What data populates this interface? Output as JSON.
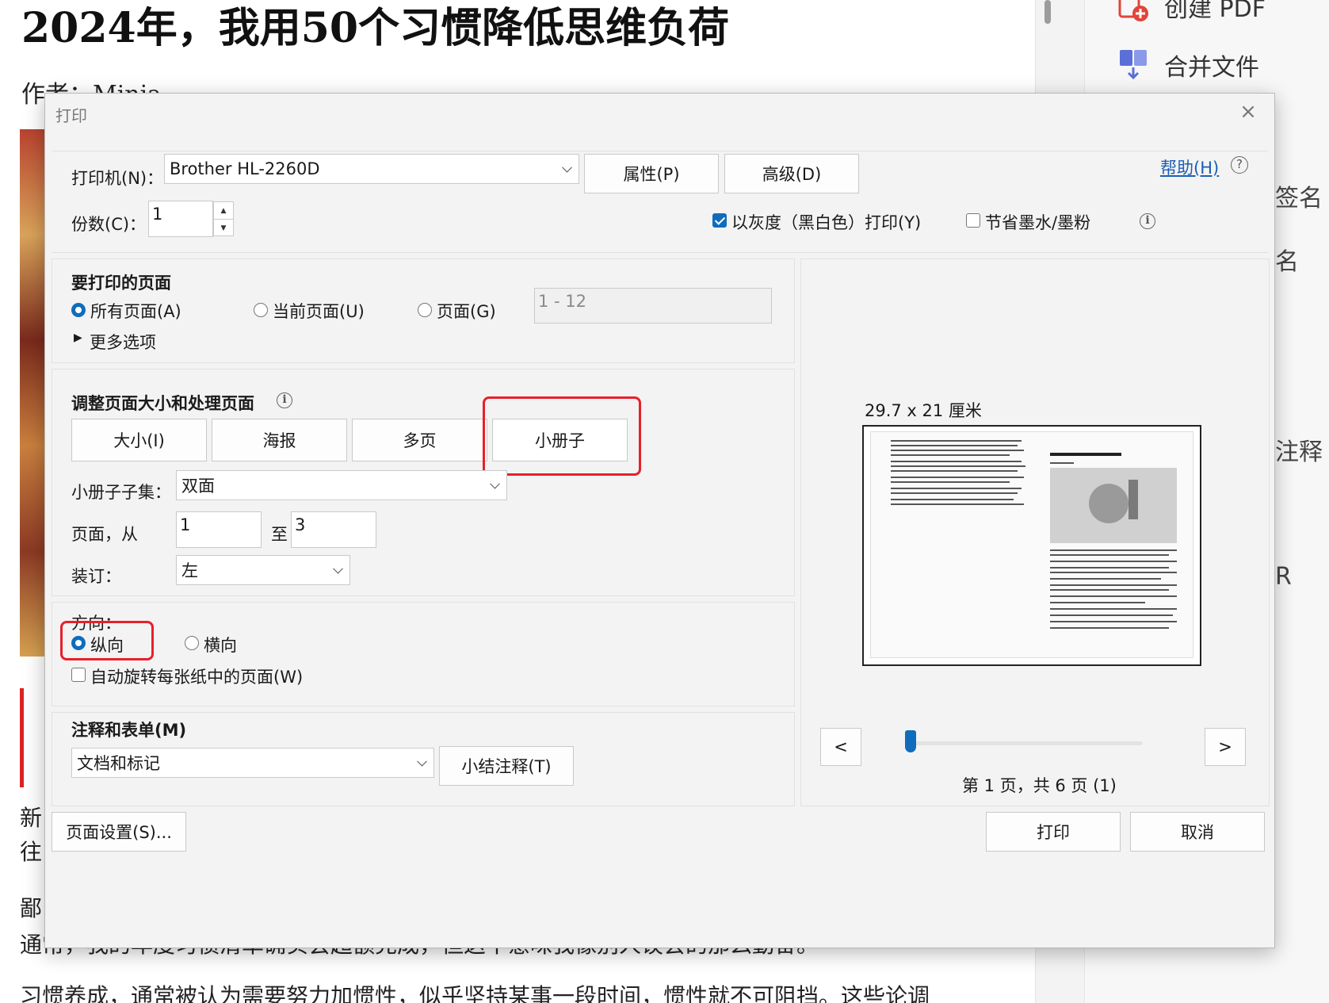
{
  "document": {
    "title": "2024年，我用50个习惯降低思维负荷",
    "author": "作者：Minja",
    "text_lines": [
      "新",
      "往",
      "鄙",
      "通常，我的年度习惯清单确实会超额完成，但这不意味我像别人误会的那么勤奋。",
      "习惯养成，通常被认为需要努力加惯性，似乎坚持某事一段时间，惯性就不可阻挡。这些论调"
    ]
  },
  "right_panel": {
    "items": [
      {
        "label": "创建 PDF",
        "icon": "create-pdf-icon"
      },
      {
        "label": "合并文件",
        "icon": "merge-files-icon"
      }
    ],
    "peeks": [
      "签名",
      "名",
      "注释",
      "R"
    ]
  },
  "dialog": {
    "title": "打印",
    "close_glyph": "×",
    "printer_label": "打印机(N)：",
    "printer_value": "Brother HL-2260D",
    "properties_button": "属性(P)",
    "advanced_button": "高级(D)",
    "help_link": "帮助(H)",
    "help_glyph": "?",
    "copies_label": "份数(C)：",
    "copies_value": "1",
    "grayscale_label": "以灰度（黑白色）打印(Y)",
    "grayscale_checked": true,
    "save_ink_label": "节省墨水/墨粉",
    "save_ink_checked": false,
    "info_glyph": "i",
    "pages_section": {
      "title": "要打印的页面",
      "all_pages": "所有页面(A)",
      "current_page": "当前页面(U)",
      "pages": "页面(G)",
      "pages_range": "1 - 12",
      "more_options": "更多选项",
      "selected": "all"
    },
    "sizing_section": {
      "title": "调整页面大小和处理页面",
      "tabs": [
        "大小(I)",
        "海报",
        "多页",
        "小册子"
      ],
      "active_tab": "小册子",
      "subset_label": "小册子子集：",
      "subset_value": "双面",
      "pages_from_label": "页面，从",
      "pages_from_value": "1",
      "pages_to_label": "至",
      "pages_to_value": "3",
      "binding_label": "装订：",
      "binding_value": "左"
    },
    "orientation_section": {
      "title": "方向：",
      "portrait": "纵向",
      "landscape": "横向",
      "selected": "portrait",
      "auto_rotate": "自动旋转每张纸中的页面(W)",
      "auto_rotate_checked": false
    },
    "comments_section": {
      "title": "注释和表单(M)",
      "value": "文档和标记",
      "summarize_button": "小结注释(T)"
    },
    "preview": {
      "paper_size": "29.7 x 21 厘米",
      "thumb_title": "2024年，我用50个习惯降低思维负荷",
      "prev_button": "<",
      "next_button": ">",
      "page_status": "第 1 页，共 6 页 (1)",
      "slider_value": 0.0
    },
    "page_setup_button": "页面设置(S)...",
    "print_button": "打印",
    "cancel_button": "取消"
  },
  "colors": {
    "accent": "#0f6cbd",
    "highlight": "#e8202a",
    "link": "#1a5fb4"
  }
}
